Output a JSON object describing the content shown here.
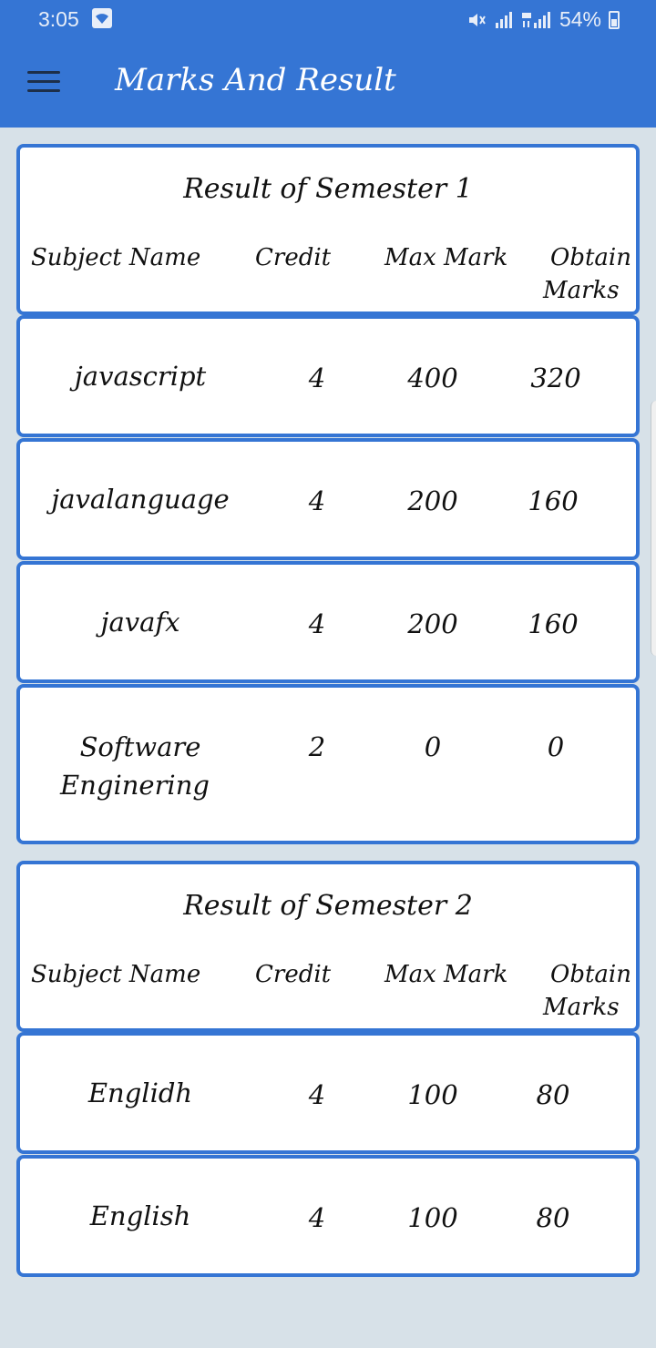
{
  "status": {
    "time": "3:05",
    "battery": "54%"
  },
  "appbar": {
    "title": "Marks And Result"
  },
  "semesters": [
    {
      "title": "Result of Semester 1",
      "headers": {
        "subject": "Subject Name",
        "credit": "Credit",
        "max": "Max Mark",
        "obtain_1": "Obtain",
        "obtain_2": "Marks"
      },
      "rows": [
        {
          "name": "javascript",
          "credit": "4",
          "max": "400",
          "obtain": "320"
        },
        {
          "name": "javalanguage",
          "credit": "4",
          "max": "200",
          "obtain": "160"
        },
        {
          "name": "javafx",
          "credit": "4",
          "max": "200",
          "obtain": "160"
        },
        {
          "name_1": "Software",
          "name_2": "Enginering",
          "credit": "2",
          "max": "0",
          "obtain": "0"
        }
      ]
    },
    {
      "title": "Result of Semester 2",
      "headers": {
        "subject": "Subject Name",
        "credit": "Credit",
        "max": "Max Mark",
        "obtain_1": "Obtain",
        "obtain_2": "Marks"
      },
      "rows": [
        {
          "name": "Englidh",
          "credit": "4",
          "max": "100",
          "obtain": "80"
        },
        {
          "name": "English",
          "credit": "4",
          "max": "100",
          "obtain": "80"
        }
      ]
    }
  ]
}
